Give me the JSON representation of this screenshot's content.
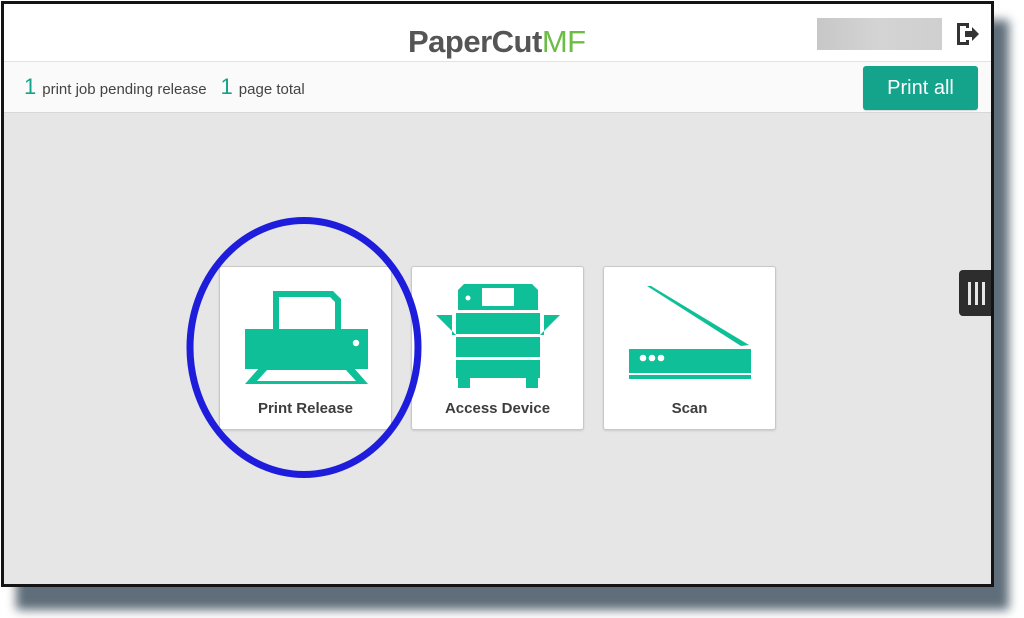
{
  "header": {
    "logo_text_main": "PaperCut",
    "logo_text_accent": "MF",
    "logout_icon": "logout-icon"
  },
  "status": {
    "job_count": "1",
    "job_label": "print job pending release",
    "page_count": "1",
    "page_label": "page total",
    "print_all_label": "Print all"
  },
  "tiles": [
    {
      "label": "Print Release",
      "icon": "printer-icon"
    },
    {
      "label": "Access Device",
      "icon": "copier-icon"
    },
    {
      "label": "Scan",
      "icon": "scanner-icon"
    }
  ],
  "side_handle_icon": "grip-icon",
  "colors": {
    "accent": "#14a38b",
    "icon": "#0fbf97",
    "logo_green": "#6cbd45",
    "annotation_circle": "#1d1ddb"
  }
}
